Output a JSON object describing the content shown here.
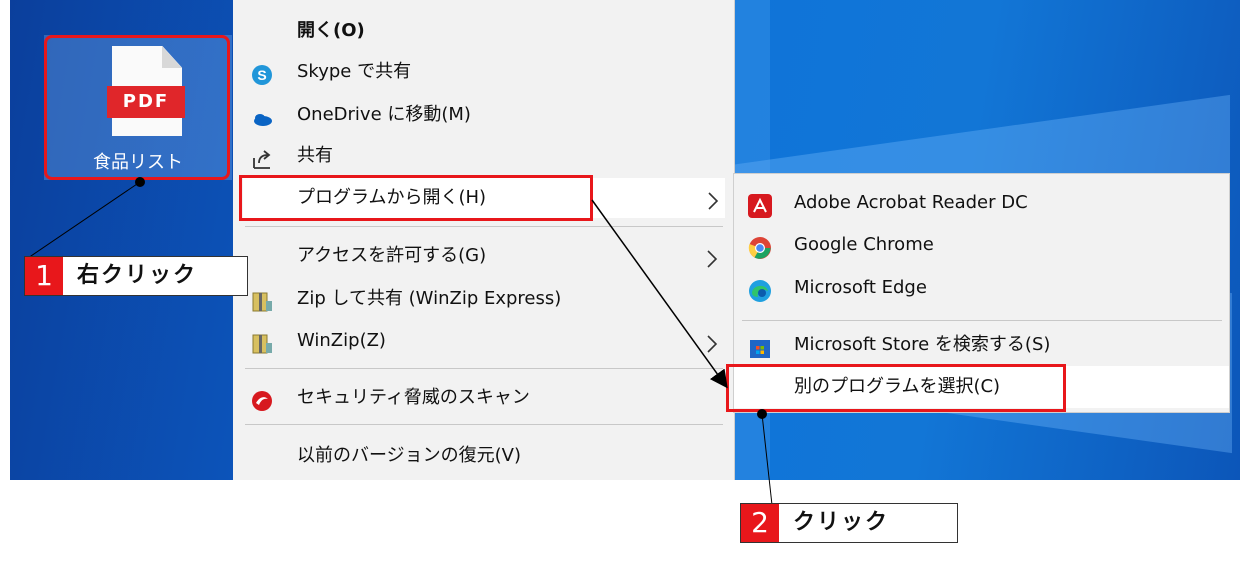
{
  "desktop_file": {
    "icon_label": "PDF",
    "name": "食品リスト"
  },
  "context_menu": {
    "items": [
      {
        "label": "開く(O)",
        "bold": true
      },
      {
        "label": "Skype で共有",
        "icon": "skype-icon"
      },
      {
        "label": "OneDrive に移動(M)",
        "icon": "onedrive-icon"
      },
      {
        "label": "共有",
        "icon": "share-icon"
      },
      {
        "label": "プログラムから開く(H)",
        "has_submenu": true
      },
      {
        "label": "アクセスを許可する(G)",
        "has_submenu": true
      },
      {
        "label": "Zip して共有 (WinZip Express)",
        "icon": "winzip-icon"
      },
      {
        "label": "WinZip(Z)",
        "icon": "winzip-icon",
        "has_submenu": true
      },
      {
        "label": "セキュリティ脅威のスキャン",
        "icon": "trend-micro-icon"
      },
      {
        "label": "以前のバージョンの復元(V)"
      }
    ]
  },
  "open_with_submenu": {
    "items": [
      {
        "label": "Adobe Acrobat Reader DC",
        "icon": "acrobat-icon"
      },
      {
        "label": "Google Chrome",
        "icon": "chrome-icon"
      },
      {
        "label": "Microsoft Edge",
        "icon": "edge-icon"
      },
      {
        "label": "Microsoft Store を検索する(S)",
        "icon": "store-icon"
      },
      {
        "label": "別のプログラムを選択(C)"
      }
    ]
  },
  "annotations": {
    "step1": {
      "number": "1",
      "text": "右クリック"
    },
    "step2": {
      "number": "2",
      "text": "クリック"
    }
  },
  "colors": {
    "highlight_red": "#e8171b",
    "desktop_blue": "#0f74d9",
    "menu_bg": "#f2f2f2"
  }
}
